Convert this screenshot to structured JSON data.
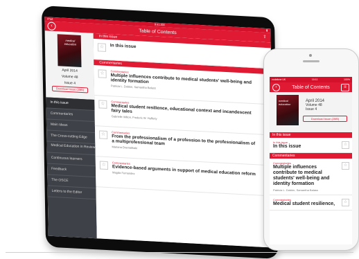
{
  "ipad": {
    "status_carrier": "iPad",
    "status_time": "9:41 AM",
    "nav_title": "Table of Contents",
    "share_icon": "share-icon",
    "cover_title": "medical education",
    "issue_date": "April 2014",
    "issue_volume": "Volume 48",
    "issue_number": "Issue 4",
    "download_label": "Download Issue (2MB)",
    "sidebar_items": [
      "In this issue",
      "Commentaries",
      "Main Ideas",
      "The Cross-cutting Edge",
      "Medical Education in Review",
      "Continuous learners",
      "Feedback",
      "The OSCE",
      "Letters to the Editor"
    ],
    "section_in_this_issue": "In this issue",
    "section_in_this_issue_item": "In this issue",
    "section_commentaries": "Commentaries",
    "articles": [
      {
        "category": "Commentaries",
        "title": "Multiple influences contribute to medical students' well-being and identity formation",
        "authors": "Patricia L. Dobkin, Samantha Balass"
      },
      {
        "category": "Commentaries",
        "title": "Medical student resilience, educational context and incandescent fairy tales",
        "authors": "Gabrielle Wilton, Frederic W. Hafferty"
      },
      {
        "category": "Commentaries",
        "title": "From the professionalism of a profession to the professionalism of a multiprofessional team",
        "authors": "Mariana Dramatikaki"
      },
      {
        "category": "Commentaries",
        "title": "Evidence-based arguments in support of medical education reform",
        "authors": "Magda Fernandez"
      }
    ]
  },
  "iphone": {
    "status_carrier": "vodafone UK",
    "status_time": "10:11",
    "status_battery": "100%",
    "nav_title": "Table of Contents",
    "menu_icon": "list-icon",
    "cover_title": "medical education",
    "issue_date": "April 2014",
    "issue_volume": "Volume 48",
    "issue_number": "Issue 4",
    "download_label": "Download Issue (2MB)",
    "section_in_this_issue": "In this issue",
    "in_this_issue_category": "In this issue",
    "in_this_issue_title": "In this issue",
    "section_commentaries": "Commentaries",
    "articles": [
      {
        "category": "Commentaries",
        "title": "Multiple influences contribute to medical students' well-being and identity formation",
        "authors": "Patricia L. Dobkin, Samantha Balass"
      },
      {
        "category": "Commentaries",
        "title": "Medical student resilience,"
      }
    ]
  },
  "colors": {
    "accent": "#e11a33",
    "sidebar_bg": "#3e4147"
  }
}
